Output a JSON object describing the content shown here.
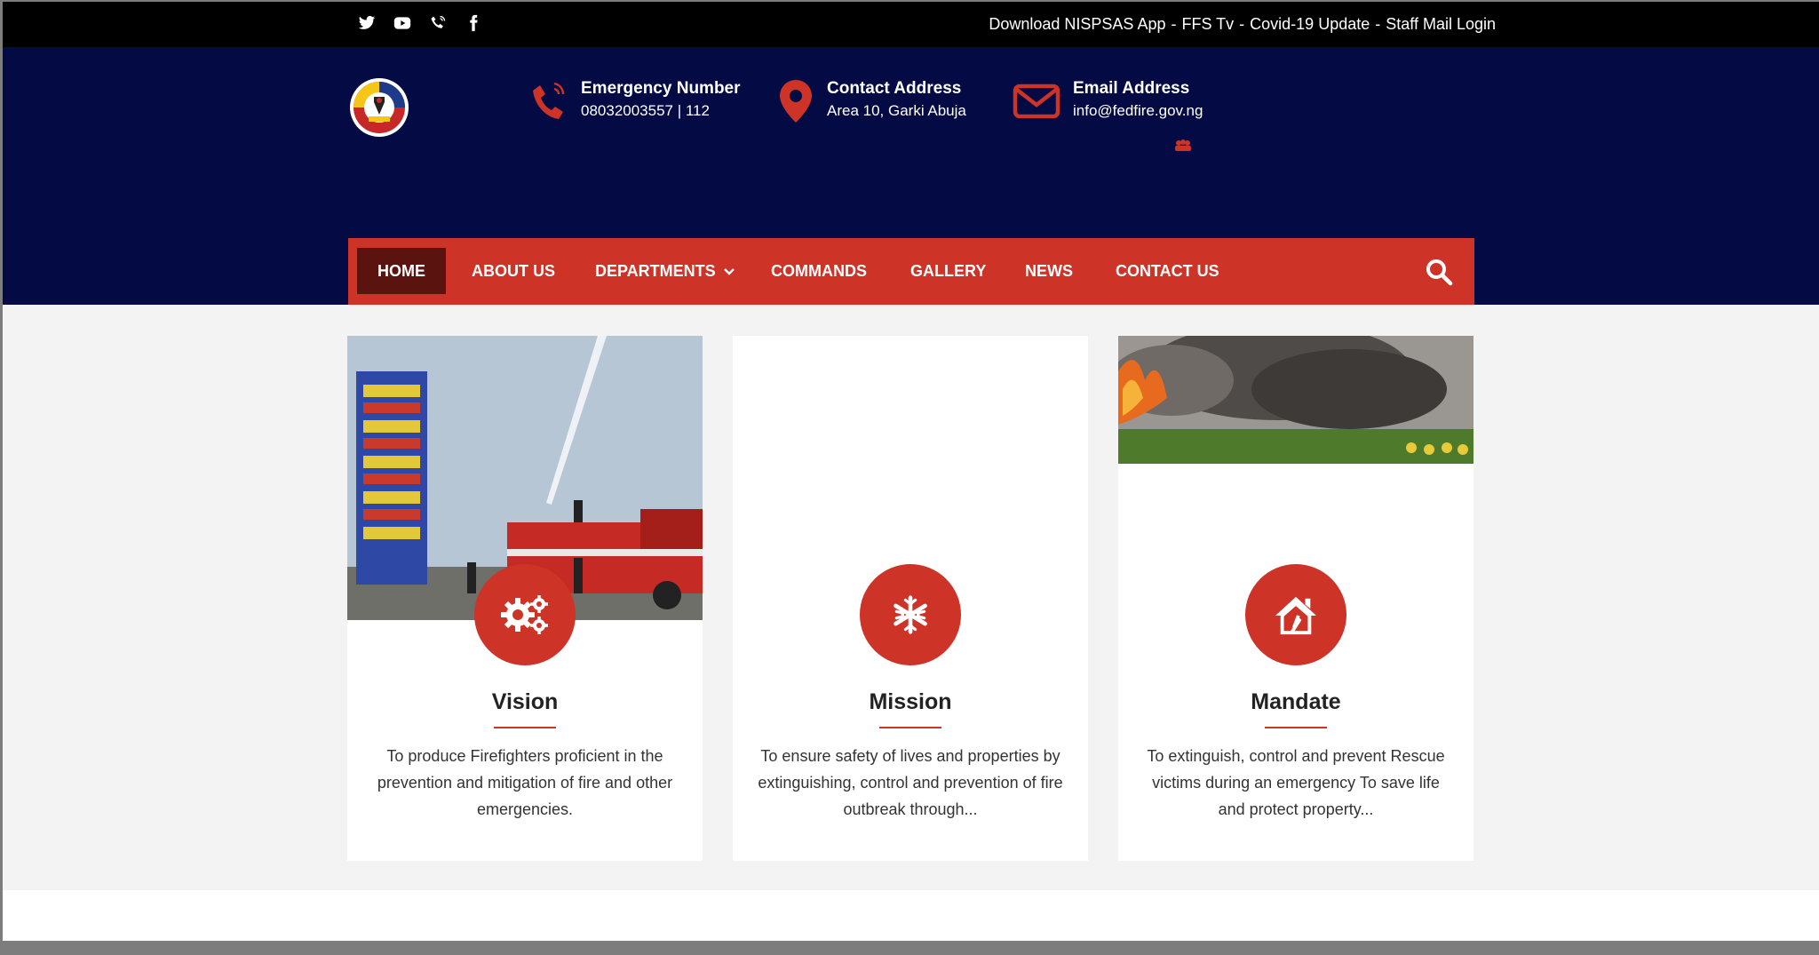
{
  "topbar": {
    "social_icons": [
      "twitter-icon",
      "youtube-icon",
      "phone-icon",
      "facebook-icon"
    ],
    "links": [
      "Download NISPSAS App",
      "FFS Tv",
      "Covid-19 Update",
      "Staff Mail Login"
    ],
    "separator": "-"
  },
  "header": {
    "emergency": {
      "title": "Emergency Number",
      "value": "08032003557 | 112"
    },
    "address": {
      "title": "Contact Address",
      "value": "Area 10, Garki Abuja"
    },
    "email": {
      "title": "Email Address",
      "value": "info@fedfire.gov.ng"
    }
  },
  "nav": {
    "items": [
      "HOME",
      "ABOUT US",
      "DEPARTMENTS",
      "COMMANDS",
      "GALLERY",
      "NEWS",
      "CONTACT US"
    ],
    "active": "HOME"
  },
  "cards": [
    {
      "title": "Vision",
      "icon": "gears-icon",
      "text": "To produce Firefighters proficient in the prevention and mitigation of fire and other emergencies."
    },
    {
      "title": "Mission",
      "icon": "snowflake-icon",
      "text": "To ensure safety of lives and properties by extinguishing, control and prevention of fire outbreak through..."
    },
    {
      "title": "Mandate",
      "icon": "home-icon",
      "text": "To extinguish, control and prevent Rescue victims during an emergency To save life and protect property..."
    }
  ],
  "colors": {
    "topbar": "#000000",
    "header": "#040b44",
    "accent": "#ce3328",
    "nav_active": "#5b1310"
  }
}
